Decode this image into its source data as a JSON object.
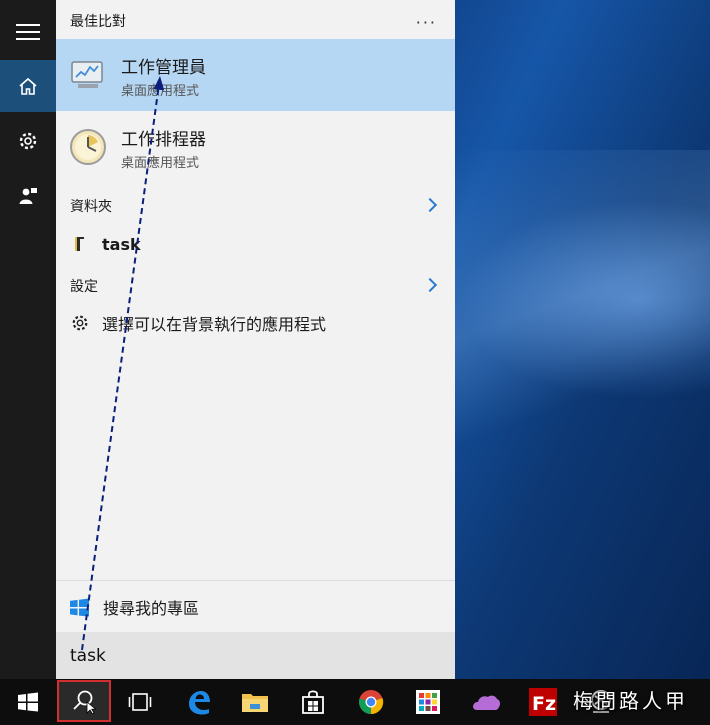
{
  "panel": {
    "best_match_heading": "最佳比對",
    "more_label": "···",
    "results": [
      {
        "title": "工作管理員",
        "subtitle": "桌面應用程式",
        "selected": true
      },
      {
        "title": "工作排程器",
        "subtitle": "桌面應用程式",
        "selected": false
      }
    ],
    "folders_heading": "資料夾",
    "folder_item": "task",
    "settings_heading": "設定",
    "settings_item": "選擇可以在背景執行的應用程式",
    "my_area_label": "搜尋我的專區"
  },
  "search": {
    "value": "task"
  },
  "taskbar": {
    "watermark": "梅問路人甲",
    "apps": [
      "edge-icon",
      "file-explorer-icon",
      "store-icon",
      "chrome-icon",
      "app-grid-icon",
      "onedrive-icon",
      "filezilla-icon",
      "netcore-icon"
    ]
  },
  "colors": {
    "selected_bg": "#b6d7f3",
    "rail_active": "#1d4f7b",
    "accent": "#2b7bd3",
    "highlight_border": "#d32f2f"
  }
}
